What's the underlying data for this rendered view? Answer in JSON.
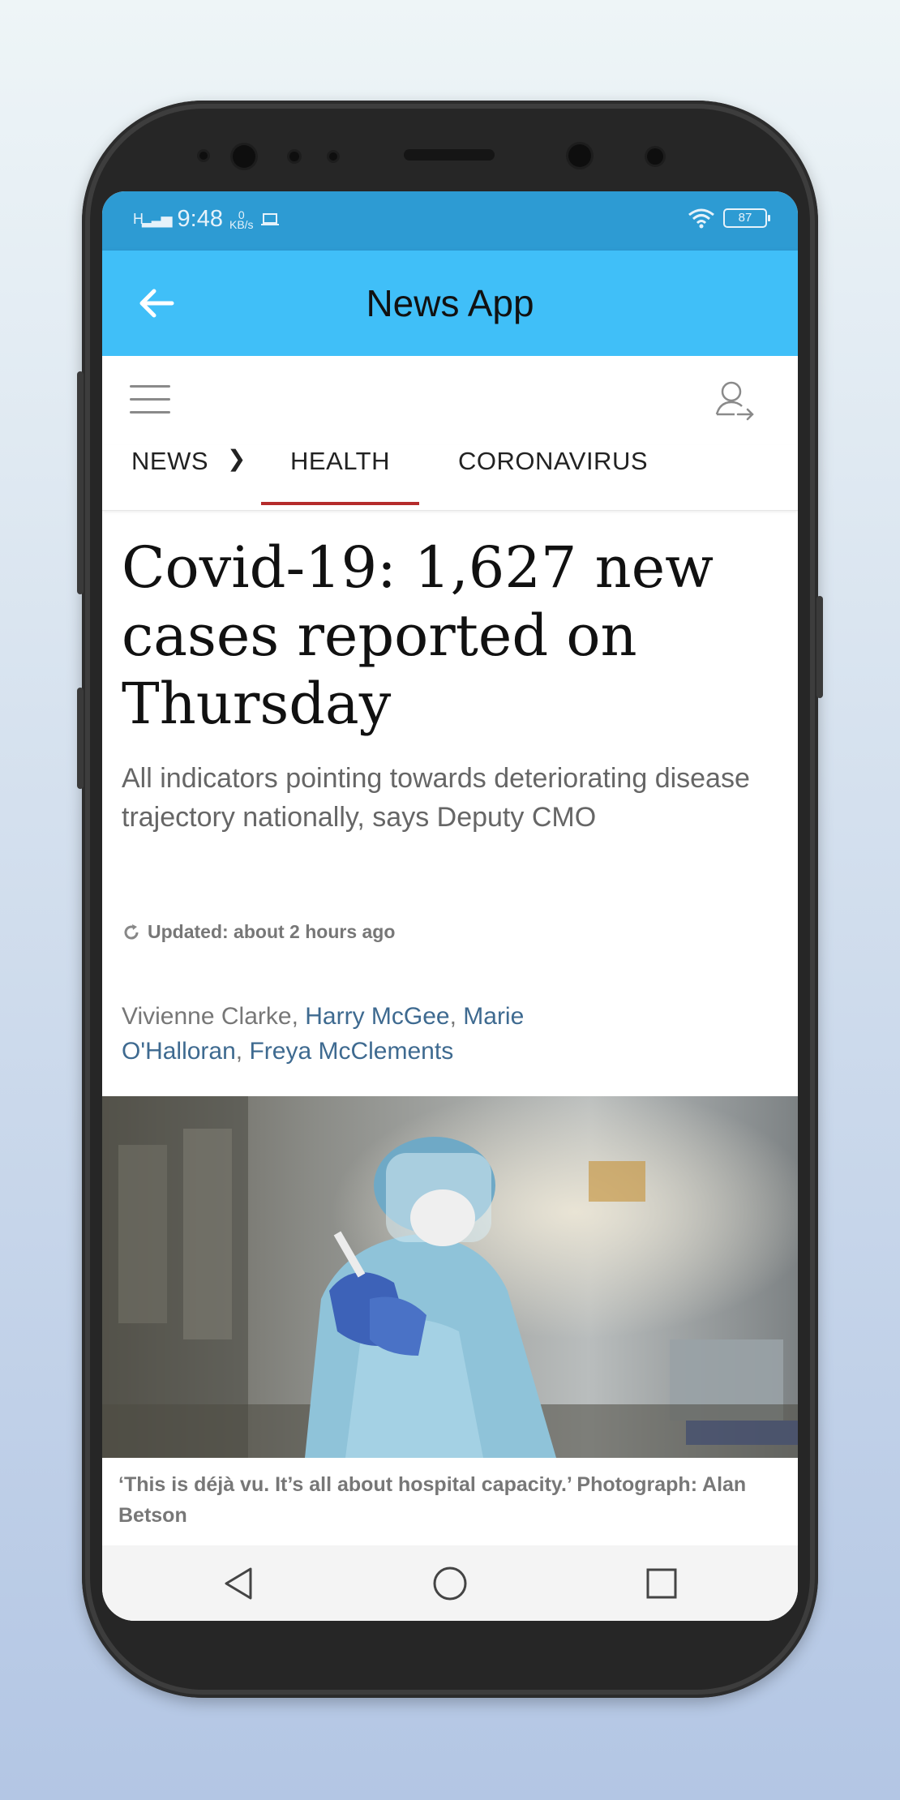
{
  "status_bar": {
    "signal": "H",
    "time": "9:48",
    "net_speed": "0\nKB/s",
    "battery": "87"
  },
  "app_bar": {
    "title": "News App"
  },
  "tabs": [
    {
      "label": "NEWS",
      "active": false
    },
    {
      "label": "HEALTH",
      "active": true
    },
    {
      "label": "CORONAVIRUS",
      "active": false
    }
  ],
  "article": {
    "headline": "Covid-19: 1,627 new cases reported on Thursday",
    "standfirst": "All indicators pointing towards deteriorating disease trajectory nationally, says Deputy CMO",
    "updated": "Updated: about 2 hours ago",
    "authors": [
      {
        "name": "Vivienne Clarke",
        "link": false
      },
      {
        "name": "Harry McGee",
        "link": true
      },
      {
        "name": "Marie O'Halloran",
        "link": true
      },
      {
        "name": "Freya McClements",
        "link": true
      }
    ],
    "caption": "‘This is déjà vu. It’s all about hospital capacity.’ Photograph: Alan Betson"
  },
  "colors": {
    "status_bar": "#2d9bd3",
    "app_bar": "#40bff8",
    "tab_indicator": "#b52b2b",
    "author_link": "#3e6a90"
  }
}
